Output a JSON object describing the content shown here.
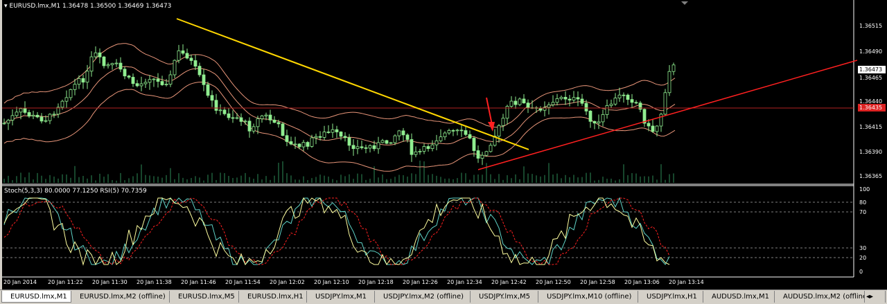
{
  "chart_title": "EURUSD.lmx,M1  1.36478 1.36500 1.36469 1.36473",
  "stoch_title": "Stoch(5,3,3) 80.0000 77.1250   RSI(5) 70.7359",
  "price_labels": [
    "1.36515",
    "1.36490",
    "1.36465",
    "1.36440",
    "1.36415",
    "1.36390",
    "1.36365"
  ],
  "current_price_tag": "1.36473",
  "level_tag": "1.36435",
  "osc_labels": [
    "100",
    "80",
    "70",
    "30",
    "20",
    "0"
  ],
  "time_labels": [
    "20 Jan 2014",
    "20 Jan 11:22",
    "20 Jan 11:30",
    "20 Jan 11:38",
    "20 Jan 11:46",
    "20 Jan 11:54",
    "20 Jan 12:02",
    "20 Jan 12:10",
    "20 Jan 12:18",
    "20 Jan 12:26",
    "20 Jan 12:34",
    "20 Jan 12:42",
    "20 Jan 12:50",
    "20 Jan 12:58",
    "20 Jan 13:06",
    "20 Jan 13:14"
  ],
  "tabs": [
    {
      "label": "EURUSD.lmx,M1",
      "active": true
    },
    {
      "label": "EURUSD.lmx,M2 (offline)"
    },
    {
      "label": "EURUSD.lmx,M5"
    },
    {
      "label": "EURUSD.lmx,H1"
    },
    {
      "label": "USDJPY.lmx,M1"
    },
    {
      "label": "USDJPY.lmx,M2 (offline)"
    },
    {
      "label": "USDJPY.lmx,M5"
    },
    {
      "label": "USDJPY.lmx,M10 (offline)"
    },
    {
      "label": "USDJPY.lmx,H1"
    },
    {
      "label": "AUDUSD.lmx,M1"
    },
    {
      "label": "AUDUSD.lmx,M2 (offline"
    }
  ],
  "colors": {
    "candle": "#90ee90",
    "bands": "#e9967a",
    "trendline_down": "#ffd700",
    "trendline_up": "#ff2020",
    "level_line": "#b22222",
    "arrow": "#ff2020",
    "stoch_main": "#5fd3c7",
    "stoch_signal": "#ff2020",
    "rsi": "#ffffa0"
  }
}
